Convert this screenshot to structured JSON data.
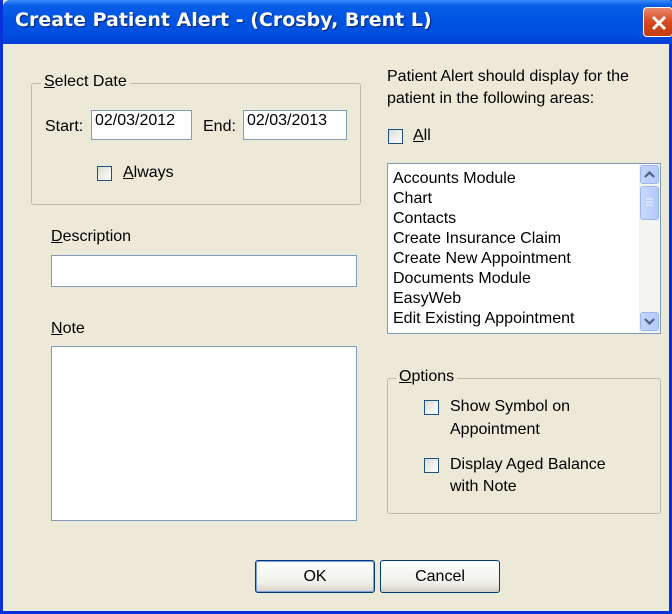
{
  "window": {
    "title": "Create Patient Alert - (Crosby, Brent L)"
  },
  "select_date": {
    "group_label": "Select Date",
    "start_label": "Start:",
    "start_value": "02/03/2012",
    "end_label": "End:",
    "end_value": "02/03/2013",
    "always_label": "Always",
    "always_checked": false
  },
  "description": {
    "label": "Description",
    "value": ""
  },
  "note": {
    "label": "Note",
    "value": ""
  },
  "areas": {
    "prompt_line1": "Patient Alert should display for the",
    "prompt_line2": "patient in the following areas:",
    "all_label": "All",
    "all_checked": false,
    "items": [
      "Accounts Module",
      "Chart",
      "Contacts",
      "Create Insurance Claim",
      "Create New Appointment",
      "Documents Module",
      "EasyWeb",
      "Edit Existing Appointment"
    ]
  },
  "options": {
    "group_label": "Options",
    "show_symbol_line1": "Show Symbol on",
    "show_symbol_line2": "Appointment",
    "show_symbol_checked": false,
    "aged_balance_line1": "Display Aged Balance",
    "aged_balance_line2": "with Note",
    "aged_balance_checked": false
  },
  "buttons": {
    "ok": "OK",
    "cancel": "Cancel"
  },
  "colors": {
    "titlebar": "#0054e3",
    "window_bg": "#ece9d8",
    "close_button": "#d9481e"
  }
}
